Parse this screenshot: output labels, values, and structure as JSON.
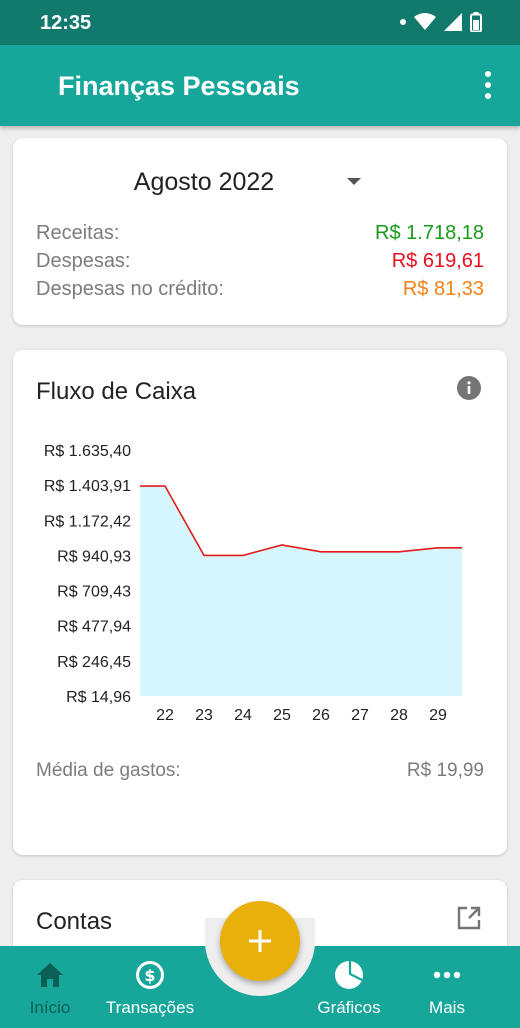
{
  "status_bar": {
    "time": "12:35"
  },
  "app_bar": {
    "title": "Finanças Pessoais",
    "menu_icon": "more-vert-icon"
  },
  "summary": {
    "month": "Agosto 2022",
    "rows": [
      {
        "label": "Receitas:",
        "value": "R$ 1.718,18",
        "color": "#1a9a1a"
      },
      {
        "label": "Despesas:",
        "value": "R$ 619,61",
        "color": "#e8101e"
      },
      {
        "label": "Despesas no crédito:",
        "value": "R$ 81,33",
        "color": "#f57f17"
      }
    ]
  },
  "cash_flow": {
    "title": "Fluxo de Caixa",
    "info_icon": "info-icon",
    "average_label": "Média de gastos:",
    "average_value": "R$ 19,99"
  },
  "chart_data": {
    "type": "area",
    "x": [
      "22",
      "23",
      "24",
      "25",
      "26",
      "27",
      "28",
      "29"
    ],
    "series": [
      {
        "values": [
          1398,
          941,
          941,
          1010,
          965,
          965,
          965,
          991
        ]
      }
    ],
    "y_tick_labels": [
      "R$ 1.635,40",
      "R$ 1.403,91",
      "R$ 1.172,42",
      "R$ 940,93",
      "R$ 709,43",
      "R$ 477,94",
      "R$ 246,45",
      "R$ 14,96"
    ],
    "y_ticks": [
      1635.4,
      1403.91,
      1172.42,
      940.93,
      709.43,
      477.94,
      246.45,
      14.96
    ],
    "ylim": [
      14.96,
      1635.4
    ],
    "line_color": "#e31b1b",
    "fill_color": "#d6f6fd",
    "grid": false
  },
  "accounts": {
    "title": "Contas",
    "open_icon": "open-external-icon"
  },
  "fab": {
    "icon": "add-icon"
  },
  "bottom_nav": {
    "items": [
      {
        "label": "Início",
        "icon": "home-icon"
      },
      {
        "label": "Transações",
        "icon": "dollar-circle-icon"
      },
      {
        "label": "Gráficos",
        "icon": "pie-chart-icon"
      },
      {
        "label": "Mais",
        "icon": "more-horiz-icon"
      }
    ]
  }
}
